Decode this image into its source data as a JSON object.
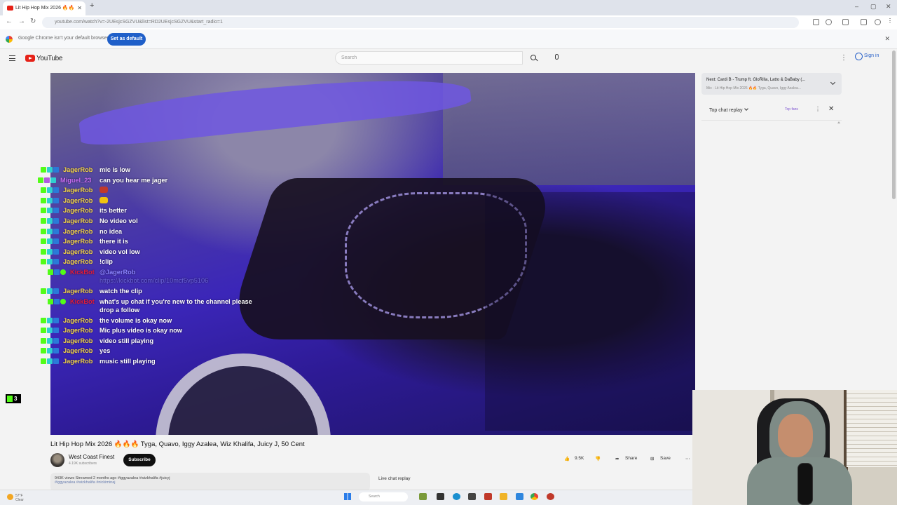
{
  "browser": {
    "tab_title": "Lit Hip Hop Mix 2026 🔥🔥",
    "url": "youtube.com/watch?v=-2UEsjcSGZVU&list=RD2UEsjcSGZVU&start_radio=1",
    "infobar_text": "Google Chrome isn't your default browser",
    "infobar_button": "Set as default"
  },
  "masthead": {
    "logo_text": "YouTube",
    "search_placeholder": "Search",
    "signin_label": "Sign in"
  },
  "video": {
    "title": "Lit Hip Hop Mix 2026 🔥🔥🔥 Tyga, Quavo, Iggy Azalea, Wiz Khalifa, Juicy J, 50 Cent",
    "channel_name": "West Coast Finest",
    "channel_subs": "4.19K subscribers",
    "subscribe_label": "Subscribe",
    "like_count": "9.5K",
    "share_label": "Share",
    "save_label": "Save",
    "desc_line1": "943K views  Streamed 2 months ago  #iggyazalea #wizkhalifa #juicyj",
    "desc_line2": "#iggyazalea #wizkhalifa #nickiminaj"
  },
  "stream_chat": [
    {
      "user": "JagerRob",
      "text": "mic is low"
    },
    {
      "user": "Miguel_23",
      "text": "can you hear me jager"
    },
    {
      "user": "JagerRob",
      "text": ""
    },
    {
      "user": "JagerRob",
      "text": ""
    },
    {
      "user": "JagerRob",
      "text": "its better"
    },
    {
      "user": "JagerRob",
      "text": "No video vol"
    },
    {
      "user": "JagerRob",
      "text": "no idea"
    },
    {
      "user": "JagerRob",
      "text": "there it is"
    },
    {
      "user": "JagerRob",
      "text": "video vol low"
    },
    {
      "user": "JagerRob",
      "text": "!clip"
    },
    {
      "user": "KickBot",
      "text": "@JagerRob",
      "link": "https://kickbot.com/clip/10mcf5vp5106"
    },
    {
      "user": "JagerRob",
      "text": "watch the clip"
    },
    {
      "user": "KickBot",
      "text": "what's up chat if you're new to the channel please",
      "text2": "drop a follow"
    },
    {
      "user": "JagerRob",
      "text": "the volume is okay now"
    },
    {
      "user": "JagerRob",
      "text": "Mic plus video is okay now"
    },
    {
      "user": "JagerRob",
      "text": "video still playing"
    },
    {
      "user": "JagerRob",
      "text": "yes"
    },
    {
      "user": "JagerRob",
      "text": "music still playing"
    }
  ],
  "kick_viewers": "3",
  "sidebar": {
    "upnext_line1": "Next: Cardi B - Trump ft. GloRilla, Latto & DaBaby (...",
    "upnext_line2": "Mix · Lit Hip Hop Mix 2026 🔥🔥 Tyga, Quavo, Iggy Azalea...",
    "chat_mode": "Top chat replay",
    "top_fans": "Top fans",
    "chat_replay_label": "Live chat replay"
  },
  "taskbar": {
    "weather_temp": "57°F",
    "weather_desc": "Clear",
    "search_placeholder": "Search"
  },
  "colors": {
    "kick_green": "#53fc18",
    "chat_username": "#f3d34a",
    "yt_red": "#e62117"
  }
}
